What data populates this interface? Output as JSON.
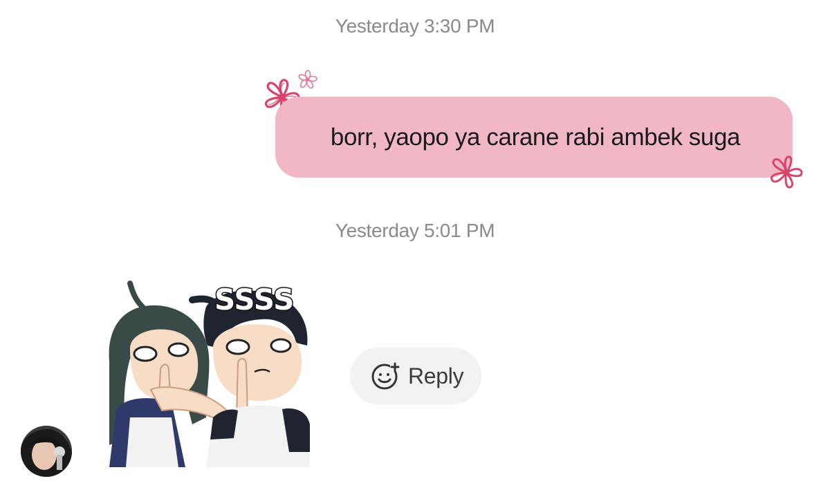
{
  "messages": [
    {
      "timestamp": "Yesterday 3:30 PM",
      "direction": "outgoing",
      "text": "borr, yaopo ya carane rabi ambek suga",
      "bubble_color": "#f2b7c5",
      "decoration": "flower-icon"
    },
    {
      "timestamp": "Yesterday 5:01 PM",
      "direction": "incoming",
      "sticker": {
        "icon": "anime-shush-sticker",
        "caption": "SSSS"
      }
    }
  ],
  "reply_button": {
    "label": "Reply",
    "icon": "smiley-add-icon"
  },
  "sender_avatar": {
    "icon": "avatar"
  },
  "colors": {
    "timestamp_text": "#8a8a8a",
    "flower": "#d9446c",
    "reply_bg": "#f2f2f2"
  }
}
